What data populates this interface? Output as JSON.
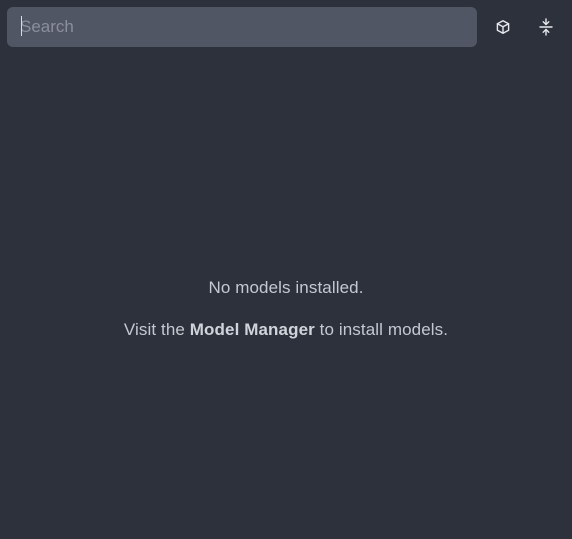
{
  "search": {
    "placeholder": "Search",
    "value": ""
  },
  "toolbar": {
    "model_icon": "cube-icon",
    "collapse_icon": "collapse-vertical-icon"
  },
  "empty_state": {
    "title": "No models installed.",
    "line_prefix": "Visit the ",
    "link_label": "Model Manager",
    "line_suffix": " to install models."
  },
  "colors": {
    "background": "#2d313b",
    "search_background": "#505663",
    "text": "#c4c8d0"
  }
}
